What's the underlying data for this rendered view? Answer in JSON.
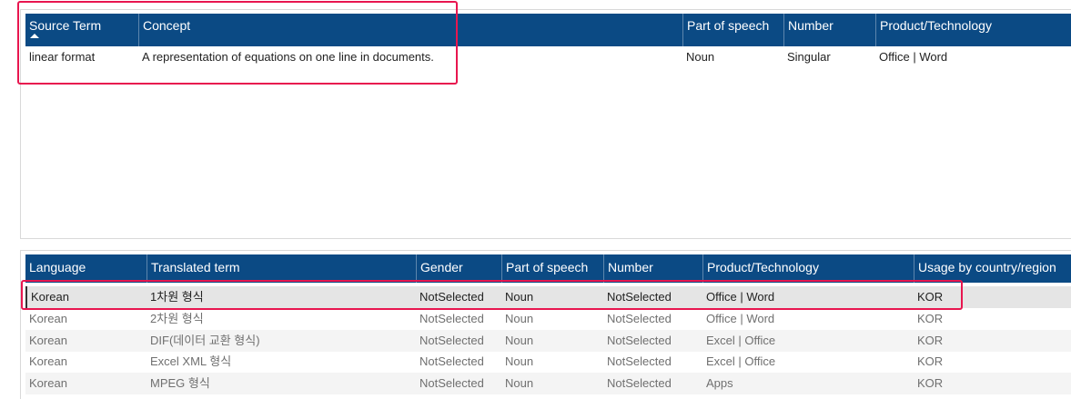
{
  "source_table": {
    "columns": [
      {
        "label": "Source Term",
        "sorted": "ascending"
      },
      {
        "label": "Concept"
      },
      {
        "label": "Part of speech"
      },
      {
        "label": "Number"
      },
      {
        "label": "Product/Technology"
      }
    ],
    "rows": [
      [
        "linear format",
        "A representation of equations on one line in documents.",
        "Noun",
        "Singular",
        "Office | Word"
      ]
    ]
  },
  "translation_table": {
    "columns": [
      {
        "label": "Language"
      },
      {
        "label": "Translated term"
      },
      {
        "label": "Gender"
      },
      {
        "label": "Part of speech"
      },
      {
        "label": "Number"
      },
      {
        "label": "Product/Technology"
      },
      {
        "label": "Usage by country/region"
      }
    ],
    "rows": [
      [
        "Korean",
        "1차원 형식",
        "NotSelected",
        "Noun",
        "NotSelected",
        "Office | Word",
        "KOR"
      ],
      [
        "Korean",
        "2차원 형식",
        "NotSelected",
        "Noun",
        "NotSelected",
        "Office | Word",
        "KOR"
      ],
      [
        "Korean",
        "DIF(데이터 교환 형식)",
        "NotSelected",
        "Noun",
        "NotSelected",
        "Excel | Office",
        "KOR"
      ],
      [
        "Korean",
        "Excel XML 형식",
        "NotSelected",
        "Noun",
        "NotSelected",
        "Excel | Office",
        "KOR"
      ],
      [
        "Korean",
        "MPEG 형식",
        "NotSelected",
        "Noun",
        "NotSelected",
        "Apps",
        "KOR"
      ]
    ]
  },
  "colors": {
    "header_bg": "#0b4a84",
    "highlight": "#e8164f",
    "selected_row": "#e5e5e5"
  }
}
